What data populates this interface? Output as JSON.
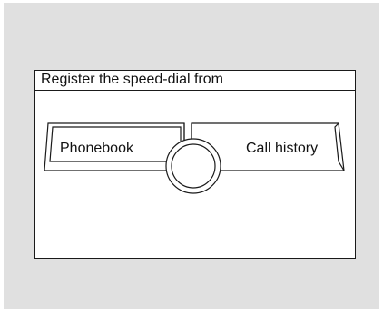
{
  "screen": {
    "title": "Register the speed-dial from"
  },
  "buttons": {
    "phonebook_label": "Phonebook",
    "call_history_label": "Call history"
  },
  "icons": {
    "center_knob": "dial-knob-icon"
  },
  "colors": {
    "background": "#e0e0e0",
    "screen": "#ffffff",
    "line": "#1a1a1a"
  }
}
